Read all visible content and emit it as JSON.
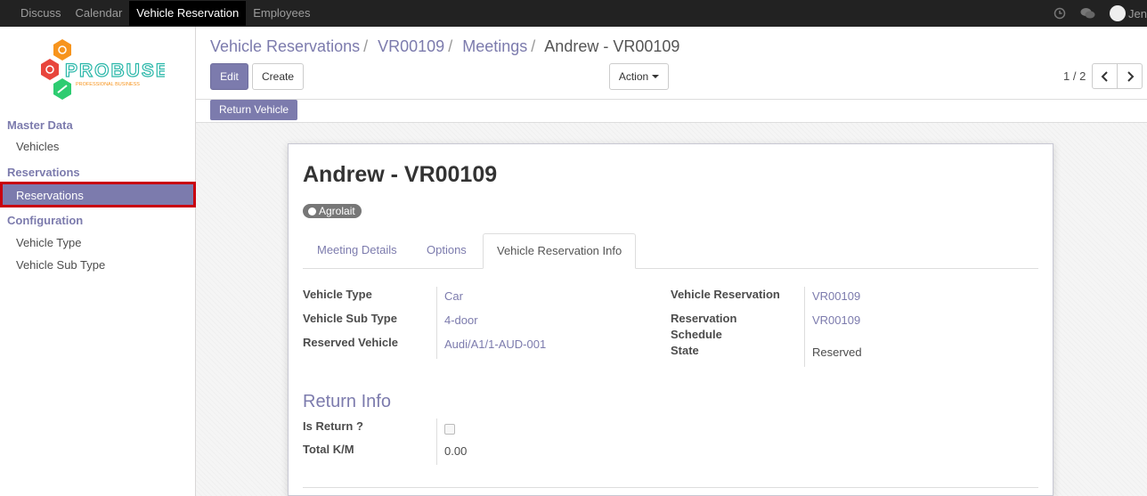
{
  "topbar": {
    "menu": [
      "Discuss",
      "Calendar",
      "Vehicle Reservation",
      "Employees"
    ],
    "active_index": 2,
    "user_name": "Jen"
  },
  "sidebar": {
    "logo_text": "PROBUSE",
    "logo_subtext": "PROFESSIONAL BUSINESS",
    "sections": [
      {
        "header": "Master Data",
        "items": [
          "Vehicles"
        ]
      },
      {
        "header": "Reservations",
        "items": [
          "Reservations"
        ]
      },
      {
        "header": "Configuration",
        "items": [
          "Vehicle Type",
          "Vehicle Sub Type"
        ]
      }
    ]
  },
  "breadcrumb": {
    "items": [
      "Vehicle Reservations",
      "VR00109",
      "Meetings"
    ],
    "current": "Andrew - VR00109"
  },
  "buttons": {
    "edit": "Edit",
    "create": "Create",
    "action": "Action",
    "return_vehicle": "Return Vehicle"
  },
  "pager": {
    "value": "1 / 2"
  },
  "record": {
    "title": "Andrew - VR00109",
    "tag": "Agrolait"
  },
  "tabs": [
    "Meeting Details",
    "Options",
    "Vehicle Reservation Info"
  ],
  "fields_left": [
    {
      "label": "Vehicle Type",
      "value": "Car"
    },
    {
      "label": "Vehicle Sub Type",
      "value": "4-door"
    },
    {
      "label": "Reserved Vehicle",
      "value": "Audi/A1/1-AUD-001"
    }
  ],
  "fields_right": {
    "vehicle_reservation_label": "Vehicle Reservation",
    "vehicle_reservation_value": "VR00109",
    "schedule_label_1": "Reservation",
    "schedule_label_2": "Schedule",
    "schedule_value": "VR00109",
    "state_label": "State",
    "state_value": "Reserved"
  },
  "return_info": {
    "title": "Return Info",
    "is_return_label": "Is Return ?",
    "is_return_checked": false,
    "total_km_label": "Total K/M",
    "total_km_value": "0.00"
  },
  "colors": {
    "accent": "#7c7bad",
    "topbar": "#222222",
    "highlight_border": "#c9000f"
  }
}
